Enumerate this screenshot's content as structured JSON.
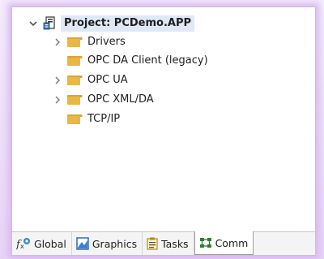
{
  "tree": {
    "root": {
      "label": "Project: PCDemo.APP",
      "icon": "project-icon",
      "expanded": true
    },
    "items": [
      {
        "label": "Drivers",
        "has_children": true,
        "icon": "folder-icon"
      },
      {
        "label": "OPC DA Client (legacy)",
        "has_children": false,
        "icon": "folder-icon"
      },
      {
        "label": "OPC UA",
        "has_children": true,
        "icon": "folder-icon"
      },
      {
        "label": "OPC XML/DA",
        "has_children": true,
        "icon": "folder-icon"
      },
      {
        "label": "TCP/IP",
        "has_children": false,
        "icon": "folder-icon"
      }
    ]
  },
  "tabs": [
    {
      "label": "Global",
      "icon": "fx-icon"
    },
    {
      "label": "Graphics",
      "icon": "graphics-icon"
    },
    {
      "label": "Tasks",
      "icon": "tasks-icon"
    },
    {
      "label": "Comm",
      "icon": "comm-icon",
      "active": true
    }
  ],
  "colors": {
    "selection": "#dfe9f6",
    "folder": "#e8b744",
    "glow": "#d9b8f1"
  }
}
